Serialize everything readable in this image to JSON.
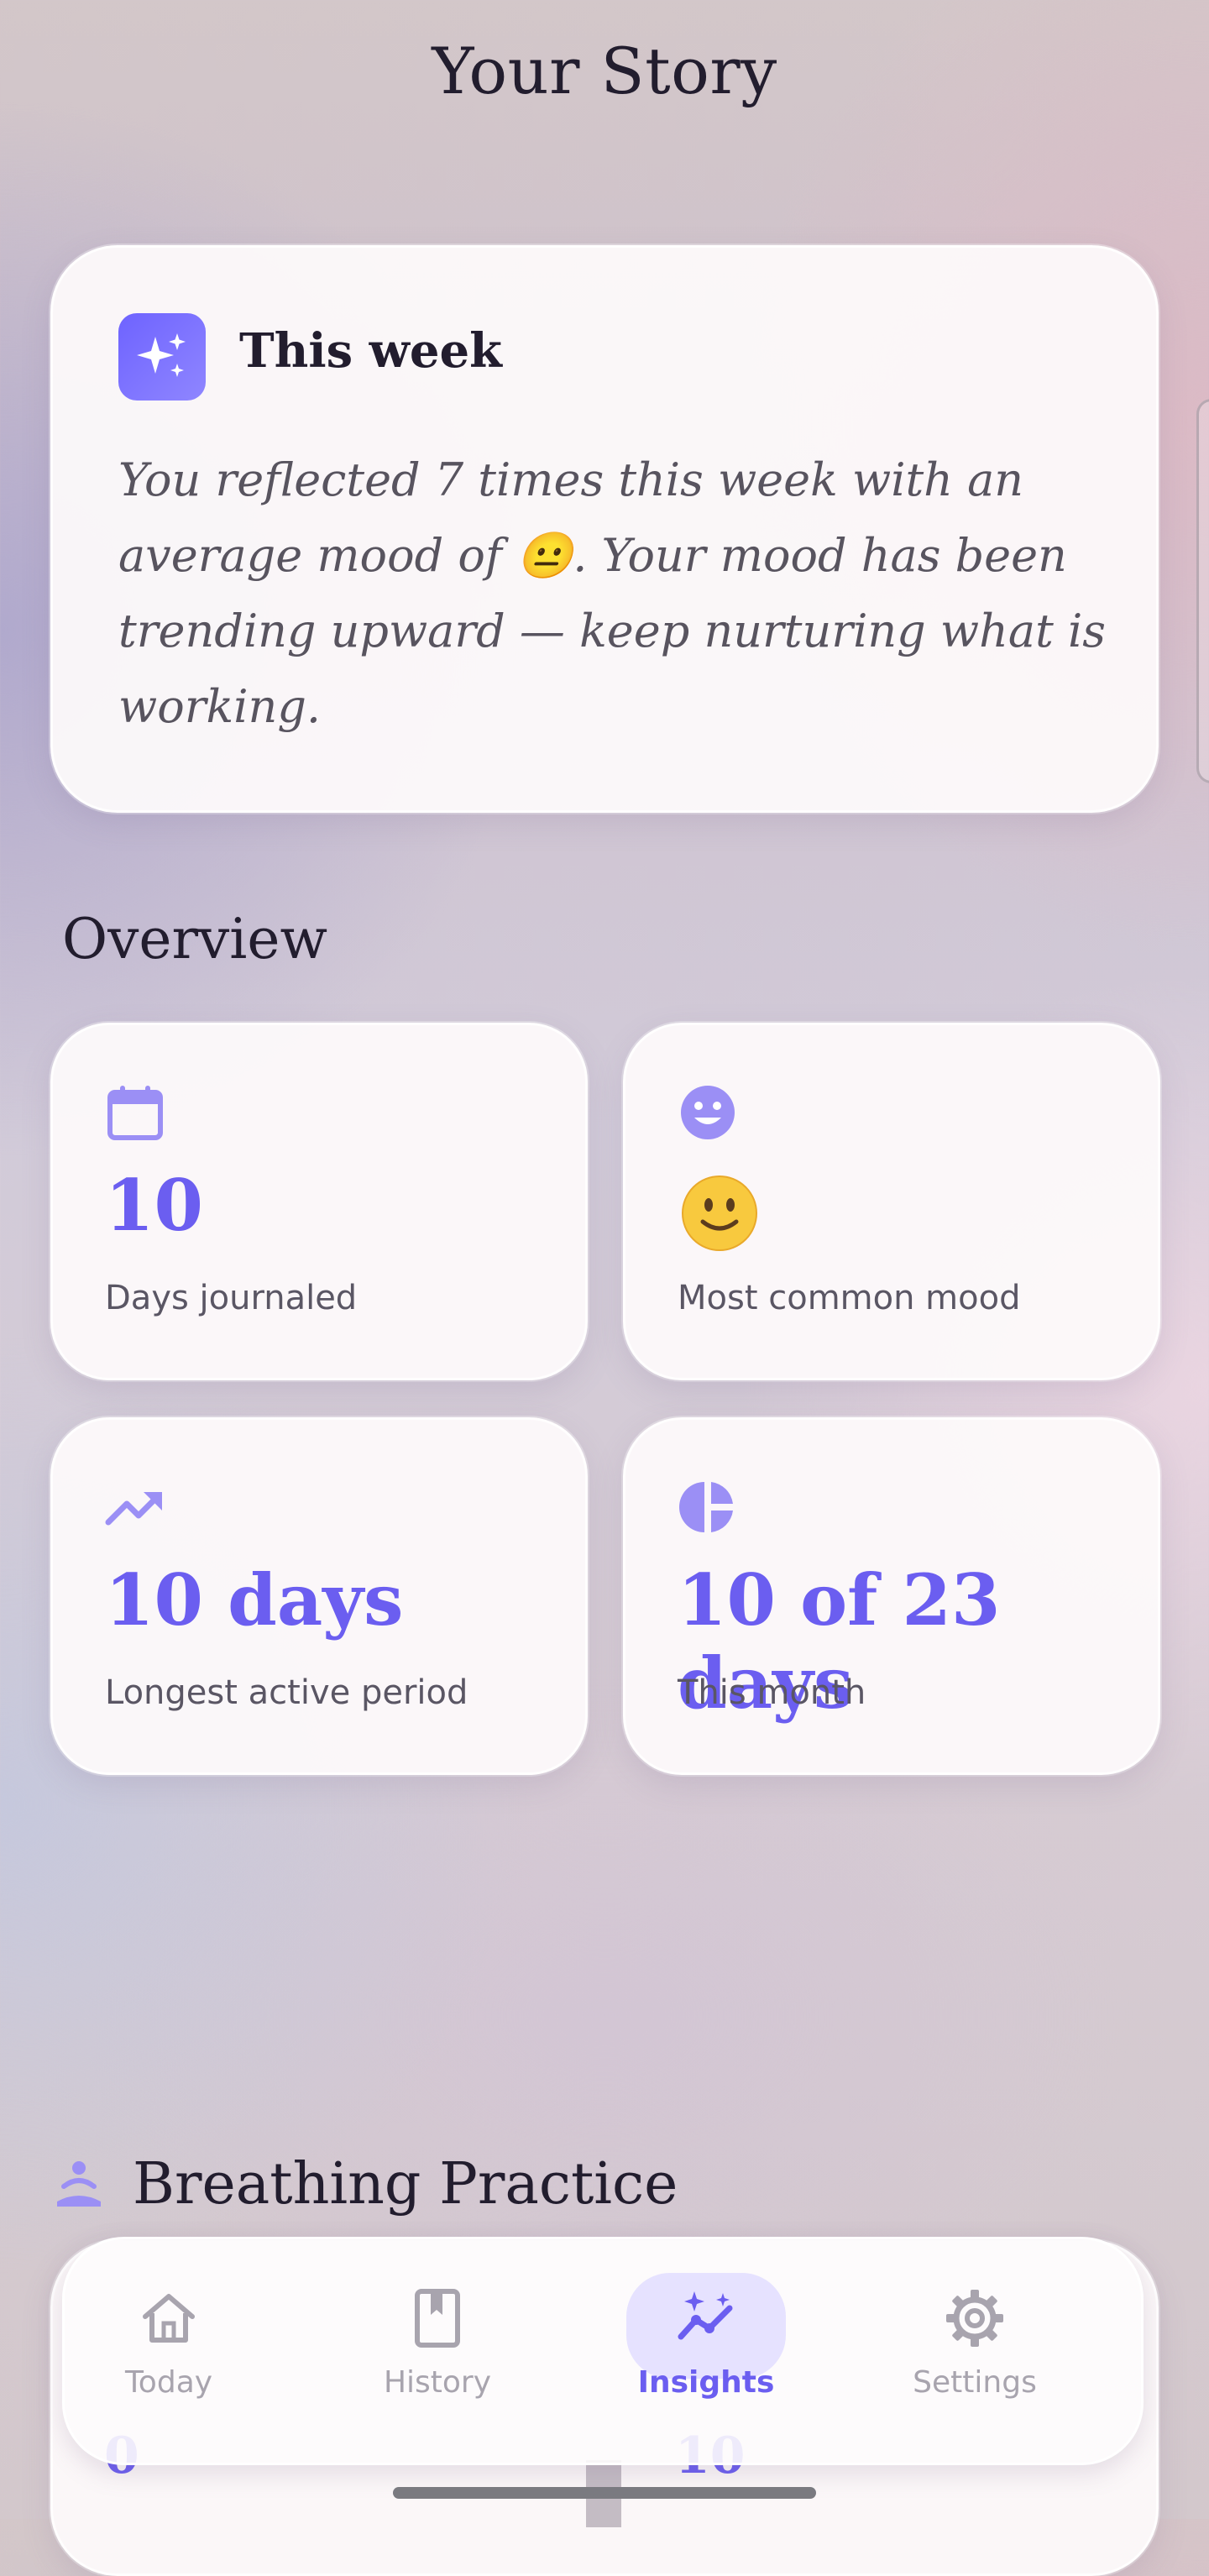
{
  "page": {
    "title": "Your Story"
  },
  "weekly_summary": {
    "title": "This week",
    "icon": "sparkles-icon",
    "text": "You reflected 7 times this week with an average mood of 😐. Your mood has been trending upward — keep nurturing what is working."
  },
  "overview": {
    "title": "Overview",
    "stats": [
      {
        "icon": "calendar-icon",
        "value": "10",
        "label": "Days journaled"
      },
      {
        "icon": "smiley-face-icon",
        "value": "🙂",
        "label": "Most common mood"
      },
      {
        "icon": "trending-up-icon",
        "value": "10 days",
        "label": "Longest active period"
      },
      {
        "icon": "pie-chart-icon",
        "value": "10 of 23 days",
        "label": "This month"
      }
    ]
  },
  "breathing": {
    "title": "Breathing Practice",
    "icon": "meditation-icon",
    "peek_left": "0",
    "peek_right": "10"
  },
  "tabbar": {
    "tabs": [
      {
        "label": "Today",
        "icon": "home-icon"
      },
      {
        "label": "History",
        "icon": "book-icon"
      },
      {
        "label": "Insights",
        "icon": "sparkle-chart-icon",
        "active": true
      },
      {
        "label": "Settings",
        "icon": "gear-icon"
      }
    ]
  },
  "colors": {
    "accent": "#6b5ef0",
    "accent_light": "#9b8ff5",
    "text_dark": "#221d2e",
    "text_muted": "#5a5664",
    "tab_inactive": "#a8a4ae"
  }
}
